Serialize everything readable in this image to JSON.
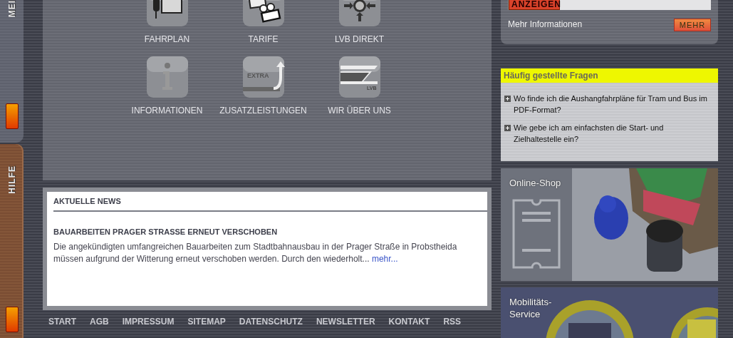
{
  "side_tabs": [
    {
      "label": "MEI",
      "kind": "menu",
      "selected": false
    },
    {
      "label": "HILFE",
      "kind": "help",
      "selected": true
    }
  ],
  "tiles": [
    {
      "label": "FAHRPLAN",
      "kind": "timetable"
    },
    {
      "label": "TARIFE",
      "kind": "tickets"
    },
    {
      "label": "LVB DIREKT",
      "kind": "direct"
    },
    {
      "label": "INFORMATIONEN",
      "kind": "info"
    },
    {
      "label": "ZUSATZLEISTUNGEN",
      "kind": "extra",
      "icon_text": "EXTRA"
    },
    {
      "label": "WIR ÜBER UNS",
      "kind": "about",
      "icon_text": "LVB"
    }
  ],
  "news": {
    "heading": "AKTUELLE NEWS",
    "title": "BAUARBEITEN PRAGER STRASSE ERNEUT VERSCHOBEN",
    "text": "Die angekündigten umfangreichen Bauarbeiten zum Stadtbahnausbau in der Prager Straße in Probstheida müssen aufgrund der Witterung erneut verschoben werden. Durch den wiederholt...",
    "link": "mehr..."
  },
  "footer_links": [
    "START",
    "AGB",
    "IMPRESSUM",
    "SITEMAP",
    "DATENSCHUTZ",
    "NEWSLETTER",
    "KONTAKT",
    "RSS"
  ],
  "ad": {
    "badge": "ANZEIGEN",
    "more_text": "Mehr Informationen",
    "button": "MEHR"
  },
  "faq": {
    "title": "Häufig gestellte Fragen",
    "items": [
      {
        "text": "Wo finde ich die Aushangfahrpläne für Tram und Bus im PDF-Format?",
        "expanded": false
      },
      {
        "text": "Wie gebe ich am einfachsten die Start- und Zielhaltestelle ein?",
        "expanded": false
      }
    ]
  },
  "promos": [
    {
      "title": "Online-Shop",
      "kind": "shop"
    },
    {
      "title": "Mobilitäts-\nService",
      "kind": "service"
    }
  ]
}
